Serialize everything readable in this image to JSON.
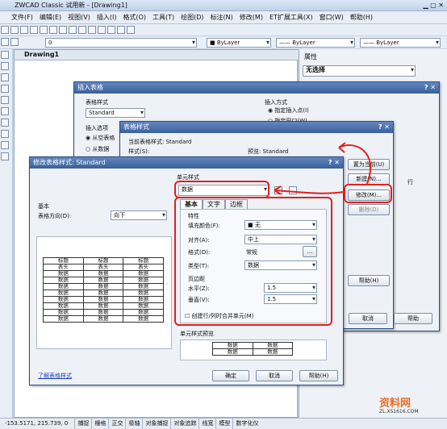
{
  "app": {
    "title": "ZWCAD Classic 试用新 - [Drawing1]"
  },
  "menu": [
    "文件(F)",
    "编辑(E)",
    "视图(V)",
    "插入(I)",
    "格式(O)",
    "工具(T)",
    "绘图(D)",
    "标注(N)",
    "修改(M)",
    "ET扩展工具(X)",
    "窗口(W)",
    "帮助(H)"
  ],
  "toolbar": {
    "layer_value": "0",
    "bylayer1": "ByLayer",
    "bylayer2": "ByLayer",
    "bylayer3": "ByLayer"
  },
  "doc_tab": "Drawing1",
  "properties": {
    "title": "属性",
    "selection": "无选择"
  },
  "insert_table": {
    "title": "插入表格",
    "table_style_label": "表格样式",
    "table_style_value": "Standard",
    "insert_options_label": "插入选项",
    "opt1": "从空表格",
    "opt2": "从数据",
    "insert_method_label": "插入方式",
    "method1": "指定插入点(I)",
    "method2": "指定窗口(W)"
  },
  "table_style": {
    "title": "表格样式",
    "current_label": "当前表格样式: Standard",
    "styles_label": "样式(S):",
    "preview_label": "预览: Standard",
    "set_current": "置为当前(U)",
    "new": "新建(N)...",
    "modify": "修改(M)...",
    "delete": "删除(D)",
    "help": "帮助(H)",
    "cancel": "取消",
    "help2": "帮助",
    "row_suffix": "行"
  },
  "modify_style": {
    "title": "修改表格样式: Standard",
    "basic_label": "基本",
    "direction_label": "表格方向(D):",
    "direction_value": "向下",
    "cell_style_label": "单元样式",
    "cell_style_value": "数据",
    "tabs": [
      "基本",
      "文字",
      "边框"
    ],
    "props_label": "特性",
    "fill_label": "填充颜色(F):",
    "fill_value": "无",
    "align_label": "对齐(A):",
    "align_value": "中上",
    "format_label": "格式(O):",
    "format_value": "常规",
    "format_btn": "...",
    "type_label": "类型(T):",
    "type_value": "数据",
    "margin_label": "页边距",
    "horiz_label": "水平(Z):",
    "horiz_value": "1.5",
    "vert_label": "垂直(V):",
    "vert_value": "1.5",
    "merge_label": "创建行/列时合并单元(M)",
    "cell_preview_label": "单元样式预览",
    "link": "了解表格样式",
    "ok": "确定",
    "cancel": "取消",
    "help": "帮助(H)",
    "preview_header": [
      "标题",
      "标题",
      "标题"
    ],
    "preview_sub": [
      "表头",
      "表头",
      "表头"
    ],
    "preview_cell": "数据",
    "cell_preview_cell": "数据"
  },
  "status": {
    "coords": "-153.5171, 215.739, 0",
    "items": [
      "捕捉",
      "栅格",
      "正交",
      "极轴",
      "对象捕捉",
      "对象追踪",
      "线宽",
      "模型",
      "数字化仪"
    ]
  },
  "watermark": {
    "text": "资料网",
    "url": "ZL.XS1616.COM"
  }
}
